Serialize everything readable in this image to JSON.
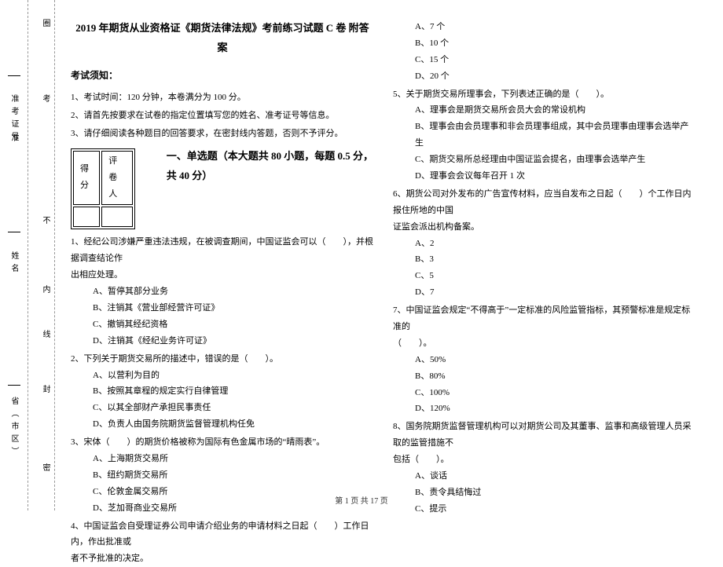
{
  "sidebar": {
    "circle1": "圈",
    "ticket_label": "准考证号",
    "kao": "考",
    "zhun": "准",
    "bu": "不",
    "name_label": "姓名",
    "nei": "内",
    "xian": "线",
    "feng": "封",
    "province": "省（市区）",
    "mi": "密"
  },
  "header": {
    "title": "2019 年期货从业资格证《期货法律法规》考前练习试题 C 卷 附答案"
  },
  "notice": {
    "title": "考试须知：",
    "l1": "1、考试时间：120 分钟，本卷满分为 100 分。",
    "l2": "2、请首先按要求在试卷的指定位置填写您的姓名、准考证号等信息。",
    "l3": "3、请仔细阅读各种题目的回答要求，在密封线内答题，否则不予评分。"
  },
  "score": {
    "c1": "得分",
    "c2": "评卷人"
  },
  "section1": "一、单选题（本大题共 80 小题，每题 0.5 分，共 40 分）",
  "q1": {
    "stem1": "1、经纪公司涉嫌严重违法违规，在被调查期间，中国证监会可以（　　），并根据调查结论作",
    "stem2": "出相应处理。",
    "a": "A、暂停其部分业务",
    "b": "B、注销其《营业部经营许可证》",
    "c": "C、撤销其经纪资格",
    "d": "D、注销其《经纪业务许可证》"
  },
  "q2": {
    "stem": "2、下列关于期货交易所的描述中，错误的是（　　）。",
    "a": "A、以营利为目的",
    "b": "B、按照其章程的规定实行自律管理",
    "c": "C、以其全部财产承担民事责任",
    "d": "D、负责人由国务院期货监督管理机构任免"
  },
  "q3": {
    "stem": "3、宋体（　　）的期货价格被称为国际有色金属市场的“晴雨表”。",
    "a": "A、上海期货交易所",
    "b": "B、纽约期货交易所",
    "c": "C、伦敦金属交易所",
    "d": "D、芝加哥商业交易所"
  },
  "q4": {
    "stem1": "4、中国证监会自受理证券公司申请介绍业务的申请材料之日起（　　）工作日内，作出批准或",
    "stem2": "者不予批准的决定。"
  },
  "q4opts": {
    "a": "A、7 个",
    "b": "B、10 个",
    "c": "C、15 个",
    "d": "D、20 个"
  },
  "q5": {
    "stem": "5、关于期货交易所理事会，下列表述正确的是（　　）。",
    "a": "A、理事会是期货交易所会员大会的常设机构",
    "b": "B、理事会由会员理事和非会员理事组成，其中会员理事由理事会选举产生",
    "c": "C、期货交易所总经理由中国证监会提名，由理事会选举产生",
    "d": "D、理事会会议每年召开 1 次"
  },
  "q6": {
    "stem1": "6、期货公司对外发布的广告宣传材料，应当自发布之日起（　　）个工作日内报住所地的中国",
    "stem2": "证监会派出机构备案。",
    "a": "A、2",
    "b": "B、3",
    "c": "C、5",
    "d": "D、7"
  },
  "q7": {
    "stem1": "7、中国证监会规定“不得高于”一定标准的风险监管指标，其预警标准是规定标准的",
    "stem2": "（　　）。",
    "a": "A、50%",
    "b": "B、80%",
    "c": "C、100%",
    "d": "D、120%"
  },
  "q8": {
    "stem1": "8、国务院期货监督管理机构可以对期货公司及其董事、监事和高级管理人员采取的监管措施不",
    "stem2": "包括（　　）。",
    "a": "A、谈话",
    "b": "B、责令具结悔过",
    "c": "C、提示"
  },
  "footer": "第 1 页 共 17 页"
}
